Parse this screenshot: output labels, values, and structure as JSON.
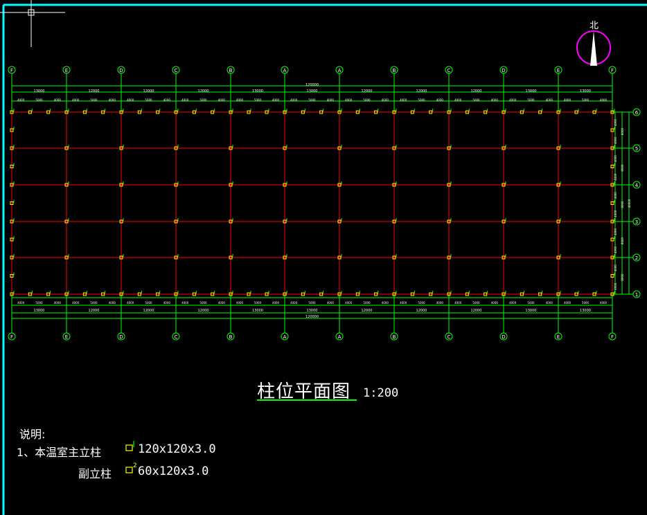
{
  "plan": {
    "axis_labels_top": [
      "F",
      "E",
      "D",
      "C",
      "B",
      "A",
      "A",
      "B",
      "C",
      "D",
      "E",
      "F"
    ],
    "axis_labels_bottom": [
      "F",
      "E",
      "D",
      "C",
      "B",
      "A",
      "A",
      "B",
      "C",
      "D",
      "E",
      "F"
    ],
    "row_labels": [
      "6",
      "5",
      "4",
      "3",
      "2",
      "1"
    ],
    "span_dims_top": [
      "13000",
      "12000",
      "12000",
      "12000",
      "13000",
      "13000",
      "12000",
      "12000",
      "12000",
      "13000",
      "13000"
    ],
    "total_dim": "120000",
    "span_dims_bottom": [
      "13000",
      "12000",
      "12000",
      "12000",
      "13000",
      "13000",
      "12000",
      "12000",
      "12000",
      "13000",
      "13000"
    ],
    "bay_dims_right": [
      "8000",
      "8000",
      "8000",
      "8000",
      "8000"
    ],
    "sub_dims_right": [
      "4000",
      "4000",
      "4000",
      "4000",
      "4000",
      "4000",
      "4000",
      "4000",
      "4000",
      "4000"
    ],
    "total_dim_right": "40000",
    "sub_dim_pattern": [
      "4000",
      "5000",
      "4000"
    ]
  },
  "north": {
    "label": "北"
  },
  "title": {
    "text": "柱位平面图",
    "scale": "1:200"
  },
  "notes": {
    "heading": "说明:",
    "item1_prefix": "1、本温室主立柱",
    "item1_spec": "120x120x3.0",
    "item2_prefix": "副立柱",
    "item2_spec": "60x120x3.0"
  },
  "colors": {
    "frame": "#00ffff",
    "grid": "#ff0000",
    "dims": "#00ff00",
    "column": "#ffff00",
    "north_circle": "#ff00ff",
    "text": "#ffffff"
  }
}
